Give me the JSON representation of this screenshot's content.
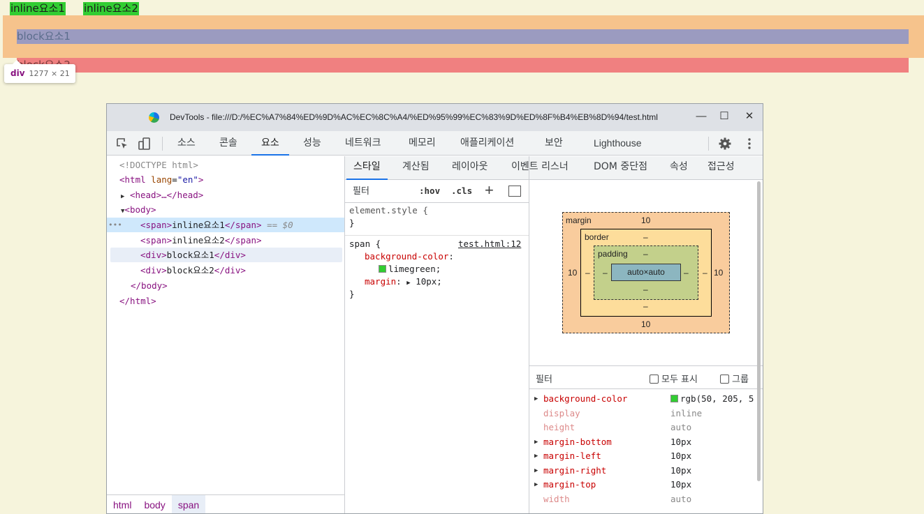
{
  "page": {
    "inline1": "inline요소1",
    "inline2": "inline요소2",
    "block1": "block요소1",
    "block2": "block요소2",
    "tooltip": {
      "tag": "div",
      "size": "1277 × 21"
    }
  },
  "window": {
    "title": "DevTools - file:///D:/%EC%A7%84%ED%9D%AC%EC%8C%A4/%ED%95%99%EC%83%9D%ED%8F%B4%EB%8D%94/test.html",
    "minimize": "—",
    "maximize": "☐",
    "close": "✕"
  },
  "toolbar": {
    "tabs": [
      "소스",
      "콘솔",
      "요소",
      "성능",
      "네트워크",
      "메모리",
      "애플리케이션",
      "보안",
      "Lighthouse"
    ],
    "active_tab": "요소"
  },
  "dom": {
    "doctype": "<!DOCTYPE html>",
    "html_open": "<html",
    "lang_attr": "lang",
    "lang_val": "\"en\"",
    "head": "<head>…</head>",
    "body_open": "<body>",
    "span1_text": "inline요소1",
    "span2_text": "inline요소2",
    "div1_text": "block요소1",
    "div2_text": "block요소2",
    "body_close": "</body>",
    "html_close": "</html>",
    "selected_marker": "== $0",
    "dots": "•••"
  },
  "breadcrumbs": [
    "html",
    "body",
    "span"
  ],
  "subtabs": [
    "스타일",
    "계산됨",
    "레이아웃",
    "이벤트 리스너",
    "DOM 중단점",
    "속성",
    "접근성"
  ],
  "styles": {
    "filter_placeholder": "필터",
    "hov": ":hov",
    "cls": ".cls",
    "element_style": "element.style {",
    "close_brace": "}",
    "rule_selector": "span {",
    "rule_source": "test.html:12",
    "bg_prop": "background-color",
    "bg_val": "limegreen;",
    "margin_prop": "margin",
    "margin_val": "10px;"
  },
  "box_model": {
    "margin_label": "margin",
    "border_label": "border",
    "padding_label": "padding",
    "margin_top": "10",
    "margin_bottom": "10",
    "margin_left": "10",
    "margin_right": "10",
    "dash": "–",
    "content": "auto×auto"
  },
  "computed": {
    "filter_label": "필터",
    "show_all": "모두 표시",
    "group": "그룹",
    "rows": [
      {
        "name": "background-color",
        "value": "rgb(50, 205, 5",
        "inherited": false,
        "expandable": true,
        "swatch": true
      },
      {
        "name": "display",
        "value": "inline",
        "inherited": true,
        "expandable": false
      },
      {
        "name": "height",
        "value": "auto",
        "inherited": true,
        "expandable": false
      },
      {
        "name": "margin-bottom",
        "value": "10px",
        "inherited": false,
        "expandable": true
      },
      {
        "name": "margin-left",
        "value": "10px",
        "inherited": false,
        "expandable": true
      },
      {
        "name": "margin-right",
        "value": "10px",
        "inherited": false,
        "expandable": true
      },
      {
        "name": "margin-top",
        "value": "10px",
        "inherited": false,
        "expandable": true
      },
      {
        "name": "width",
        "value": "auto",
        "inherited": true,
        "expandable": false
      }
    ]
  },
  "colors": {
    "limegreen": "#32cd32",
    "accent": "#1a73e8",
    "tag": "#881280"
  }
}
